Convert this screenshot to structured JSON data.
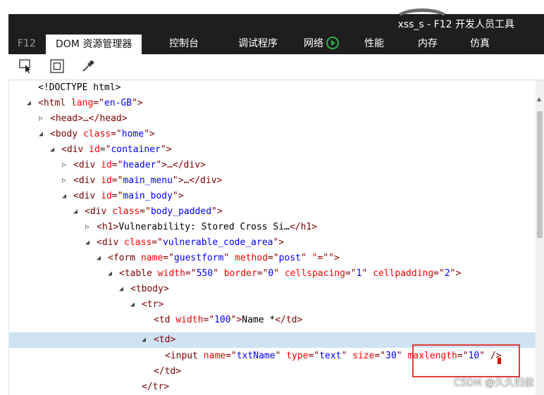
{
  "window": {
    "title": "xss_s - F12 开发人员工具"
  },
  "tabs": [
    {
      "label": "F12"
    },
    {
      "label": "DOM 资源管理器"
    },
    {
      "label": "控制台"
    },
    {
      "label": "调试程序"
    },
    {
      "label": "网络"
    },
    {
      "label": "性能"
    },
    {
      "label": "内存"
    },
    {
      "label": "仿真"
    }
  ],
  "toolbar": {
    "tools": [
      {
        "icon": "select-element-icon"
      },
      {
        "icon": "highlight-element-icon"
      },
      {
        "icon": "color-picker-icon"
      }
    ]
  },
  "dom_tree": {
    "n0": {
      "t1": "<!DOCTYPE html>"
    },
    "n1": {
      "t1": "<html ",
      "a1": "lang",
      "t2": "=\"",
      "v1": "en-GB",
      "t3": "\">"
    },
    "n2": {
      "t1": "<head>…</head>"
    },
    "n3": {
      "t1": "<body ",
      "a1": "class",
      "t2": "=\"",
      "v1": "home",
      "t3": "\">"
    },
    "n4": {
      "t1": "<div ",
      "a1": "id",
      "t2": "=\"",
      "v1": "container",
      "t3": "\">"
    },
    "n5": {
      "t1": "<div ",
      "a1": "id",
      "t2": "=\"",
      "v1": "header",
      "t3": "\">…</div>"
    },
    "n6": {
      "t1": "<div ",
      "a1": "id",
      "t2": "=\"",
      "v1": "main_menu",
      "t3": "\">…</div>"
    },
    "n7": {
      "t1": "<div ",
      "a1": "id",
      "t2": "=\"",
      "v1": "main_body",
      "t3": "\">"
    },
    "n8": {
      "t1": "<div ",
      "a1": "class",
      "t2": "=\"",
      "v1": "body_padded",
      "t3": "\">"
    },
    "n9": {
      "t1": "<h1>",
      "x1": "Vulnerability: Stored Cross Si…",
      "t2": "</h1>"
    },
    "n10": {
      "t1": "<div ",
      "a1": "class",
      "t2": "=\"",
      "v1": "vulnerable_code_area",
      "t3": "\">"
    },
    "n11": {
      "t1": "<form ",
      "a1": "name",
      "t2": "=\"",
      "v1": "guestform",
      "t3": "\" ",
      "a2": "method",
      "t4": "=\"",
      "v2": "post",
      "t5": "\" ",
      "a3": "\"",
      "t6": "=\"",
      "t7": "\">"
    },
    "n12": {
      "t1": "<table ",
      "a1": "width",
      "t2": "=\"",
      "v1": "550",
      "t3": "\" ",
      "a2": "border",
      "t4": "=\"",
      "v2": "0",
      "t5": "\" ",
      "a3": "cellspacing",
      "t6": "=\"",
      "v3": "1",
      "t7": "\" ",
      "a4": "cellpadding",
      "t8": "=\"",
      "v4": "2",
      "t9": "\">"
    },
    "n13": {
      "t1": "<tbody>"
    },
    "n14": {
      "t1": "<tr>"
    },
    "n15": {
      "t1": "<td ",
      "a1": "width",
      "t2": "=\"",
      "v1": "100",
      "t3": "\">",
      "x1": "Name *",
      "t4": "</td>"
    },
    "n16": {
      "t1": "<td>"
    },
    "n17": {
      "t1": "<input ",
      "a1": "name",
      "t2": "=\"",
      "v1": "txtName",
      "t3": "\" ",
      "a2": "type",
      "t4": "=\"",
      "v2": "text",
      "t5": "\" ",
      "a3": "size",
      "t6": "=\"",
      "v3": "30",
      "t7": "\" ",
      "a4": "maxlength",
      "t8": "=\"",
      "v4": "10",
      "t9": "\"",
      "t10": " />"
    },
    "n18": {
      "t1": "</td>"
    },
    "n19": {
      "t1": "</tr>"
    }
  },
  "watermark": "CSDN @久久归依",
  "colors": {
    "tag": "#7a0000",
    "attribute": "#ff0000",
    "value": "#0000ff",
    "selection": "#cfe3f2",
    "annotation": "#e23b3b",
    "titlebar": "#1e1e1e"
  }
}
